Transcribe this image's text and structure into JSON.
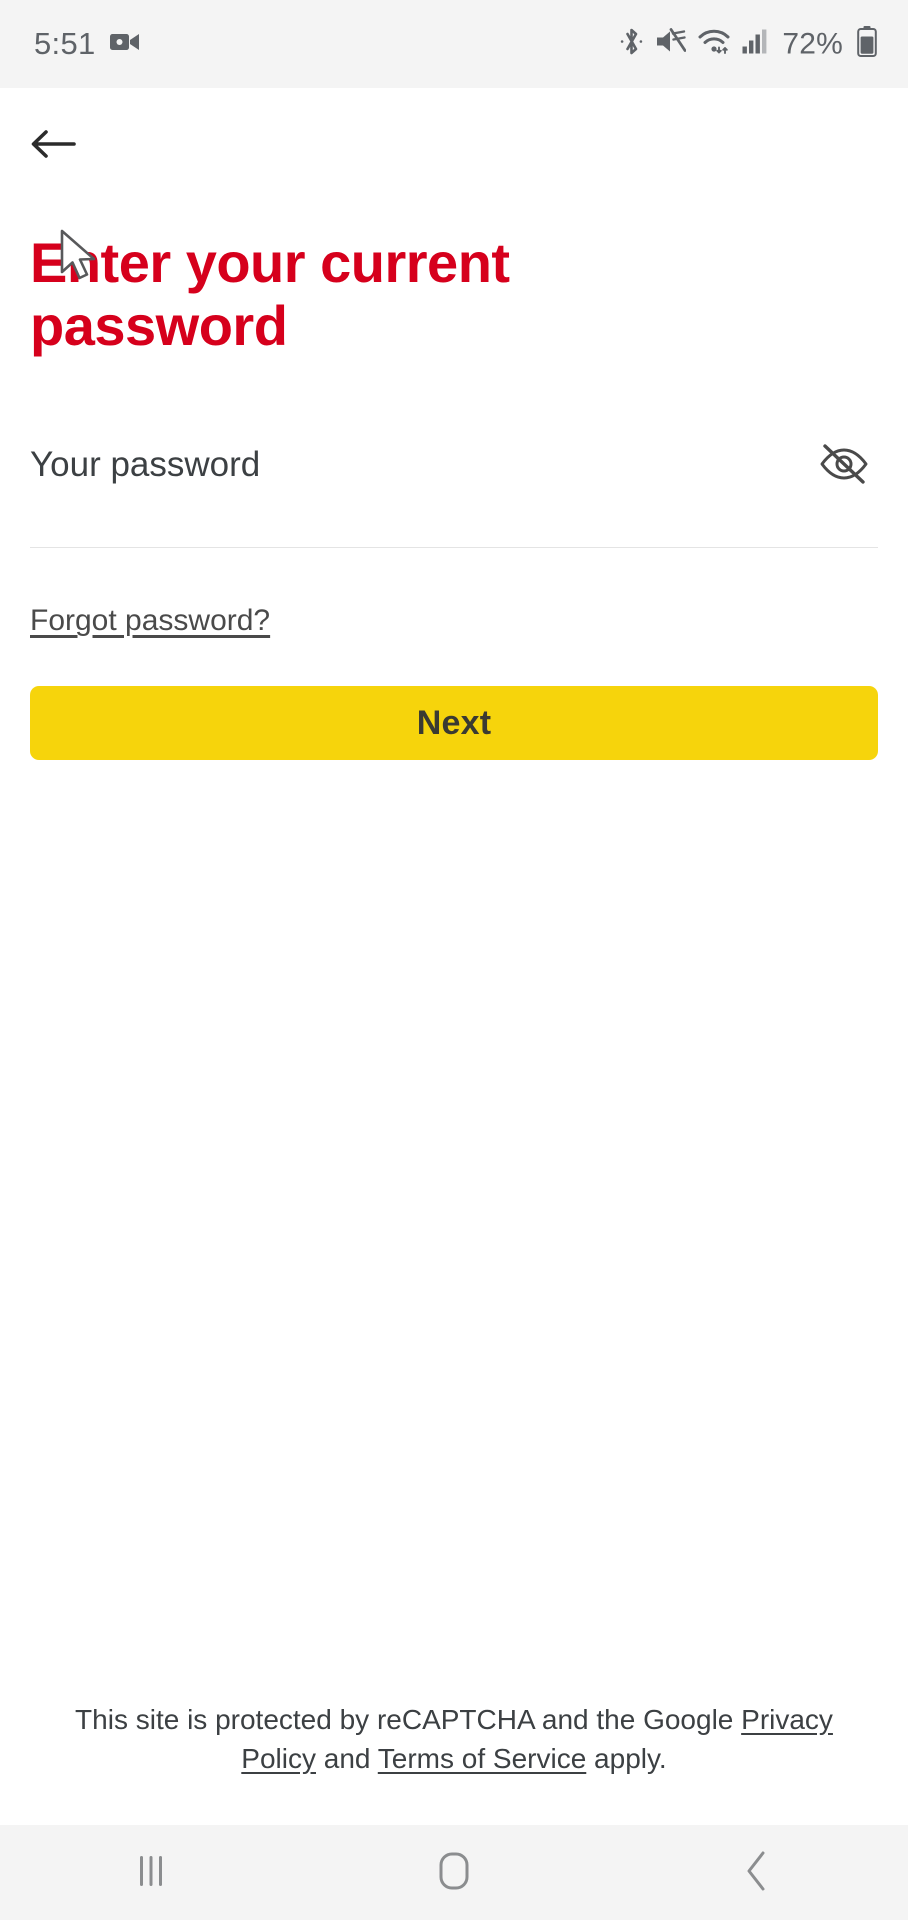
{
  "status_bar": {
    "time": "5:51",
    "battery_percent": "72%",
    "icons": {
      "camera": "video-camera-icon",
      "bluetooth": "bluetooth-icon",
      "mute": "volume-mute-icon",
      "wifi": "wifi-icon",
      "signal": "cellular-signal-icon",
      "battery": "battery-icon"
    }
  },
  "header": {
    "back_label": "Back",
    "back_icon": "arrow-left-icon"
  },
  "main": {
    "title": "Enter your current password",
    "password_field": {
      "placeholder": "Your password",
      "value": "",
      "toggle_icon": "eye-off-icon",
      "toggle_label": "Show password"
    },
    "forgot_link": "Forgot password?",
    "submit_label": "Next"
  },
  "footer": {
    "recaptcha_prefix": "This site is protected by reCAPTCHA and the Google ",
    "privacy_policy": "Privacy Policy",
    "conjunction": " and ",
    "terms_of_service": "Terms of Service",
    "suffix": " apply."
  },
  "nav_bar": {
    "recents_label": "Recents",
    "home_label": "Home",
    "back_label": "Back"
  },
  "colors": {
    "brand_red": "#D6001C",
    "accent_yellow": "#F6D40C",
    "status_bg": "#F4F4F4",
    "text_dark": "#3C4043",
    "divider": "#E4E4E4"
  }
}
